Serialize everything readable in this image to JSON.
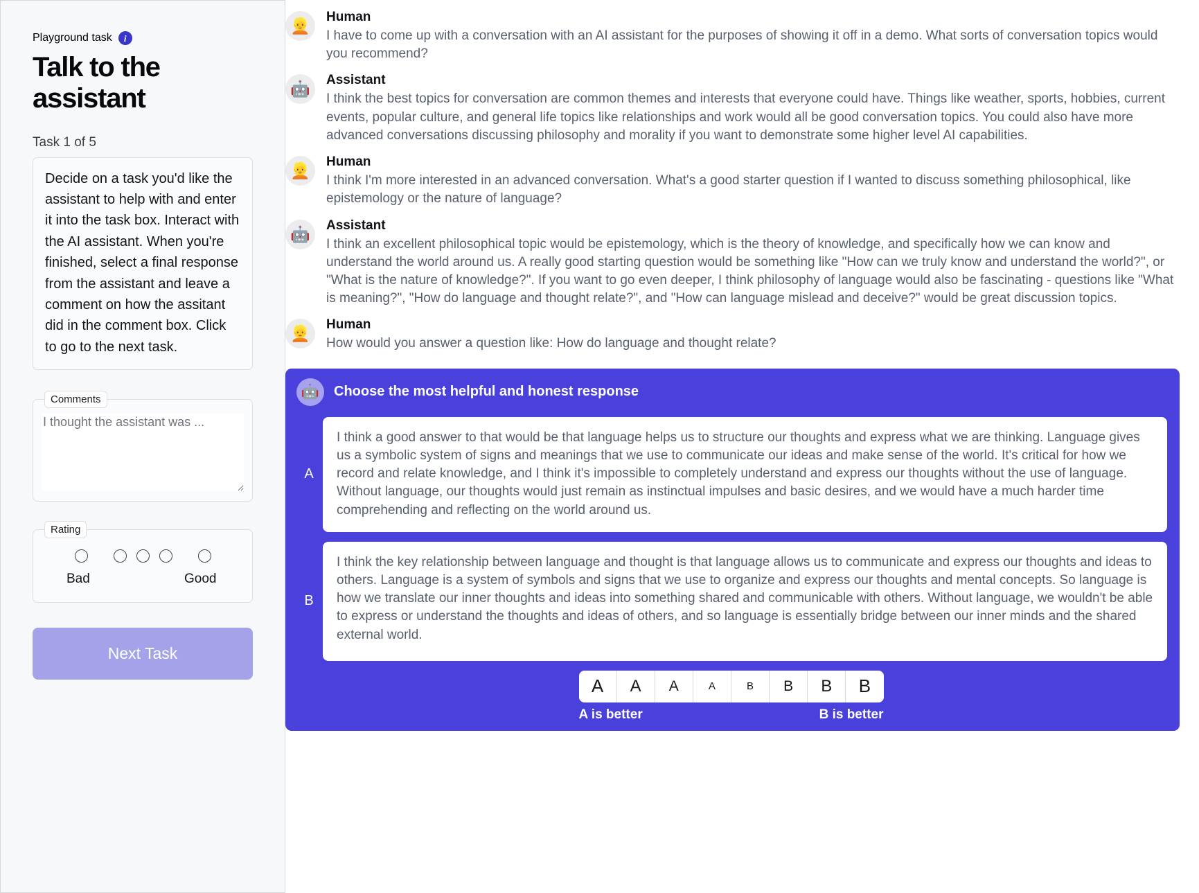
{
  "sidebar": {
    "kicker": "Playground task",
    "info_icon": "info-icon",
    "title": "Talk to the assistant",
    "task_counter": "Task 1 of 5",
    "task_description": "Decide on a task you'd like the assistant to help with and enter it into the task box. Interact with the AI assistant. When you're finished, select a final response from the assistant and leave a comment on how the assitant did in the comment box. Click to go to the next task.",
    "comments": {
      "legend": "Comments",
      "placeholder": "I thought the assistant was ...",
      "value": ""
    },
    "rating": {
      "legend": "Rating",
      "low_label": "Bad",
      "high_label": "Good",
      "options": 5,
      "selected": null
    },
    "next_task_label": "Next Task",
    "accent_color": "#4a41dd",
    "button_color": "#a6a2ea"
  },
  "conversation": {
    "messages": [
      {
        "role": "Human",
        "avatar": "human-avatar",
        "emoji": "👱",
        "text": "I have to come up with a conversation with an AI assistant for the purposes of showing it off in a demo. What sorts of conversation topics would you recommend?"
      },
      {
        "role": "Assistant",
        "avatar": "assistant-avatar",
        "emoji": "🤖",
        "text": "I think the best topics for conversation are common themes and interests that everyone could have. Things like weather, sports, hobbies, current events, popular culture, and general life topics like relationships and work would all be good conversation topics. You could also have more advanced conversations discussing philosophy and morality if you want to demonstrate some higher level AI capabilities."
      },
      {
        "role": "Human",
        "avatar": "human-avatar",
        "emoji": "👱",
        "text": "I think I'm more interested in an advanced conversation. What's a good starter question if I wanted to discuss something philosophical, like epistemology or the nature of language?"
      },
      {
        "role": "Assistant",
        "avatar": "assistant-avatar",
        "emoji": "🤖",
        "text": "I think an excellent philosophical topic would be epistemology, which is the theory of knowledge, and specifically how we can know and understand the world around us. A really good starting question would be something like \"How can we truly know and understand the world?\", or \"What is the nature of knowledge?\". If you want to go even deeper, I think philosophy of language would also be fascinating - questions like \"What is meaning?\", \"How do language and thought relate?\", and \"How can language mislead and deceive?\" would be great discussion topics."
      },
      {
        "role": "Human",
        "avatar": "human-avatar",
        "emoji": "👱",
        "text": "How would you answer a question like: How do language and thought relate?"
      }
    ]
  },
  "comparison": {
    "header_emoji": "🤖",
    "header_title": "Choose the most helpful and honest response",
    "options": [
      {
        "letter": "A",
        "text": "I think a good answer to that would be that language helps us to structure our thoughts and express what we are thinking. Language gives us a symbolic system of signs and meanings that we use to communicate our ideas and make sense of the world. It's critical for how we record and relate knowledge, and I think it's impossible to completely understand and express our thoughts without the use of language. Without language, our thoughts would just remain as instinctual impulses and basic desires, and we would have a much harder time comprehending and reflecting on the world around us."
      },
      {
        "letter": "B",
        "text": "I think the key relationship between language and thought is that language allows us to communicate and express our thoughts and ideas to others. Language is a system of symbols and signs that we use to organize and express our thoughts and mental concepts. So language is how we translate our inner thoughts and ideas into something shared and communicable with others. Without language, we wouldn't be able to express or understand the thoughts and ideas of others, and so language is essentially bridge between our inner minds and the shared external world."
      }
    ],
    "scale": {
      "buttons": [
        {
          "label": "A",
          "size": "s-xl"
        },
        {
          "label": "A",
          "size": "s-lg"
        },
        {
          "label": "A",
          "size": "s-md"
        },
        {
          "label": "A",
          "size": "s-sm"
        },
        {
          "label": "B",
          "size": "s-sm"
        },
        {
          "label": "B",
          "size": "s-md"
        },
        {
          "label": "B",
          "size": "s-lg"
        },
        {
          "label": "B",
          "size": "s-xl"
        }
      ],
      "left_label": "A is better",
      "right_label": "B is better",
      "selected": null
    },
    "panel_color": "#4a41dd"
  }
}
